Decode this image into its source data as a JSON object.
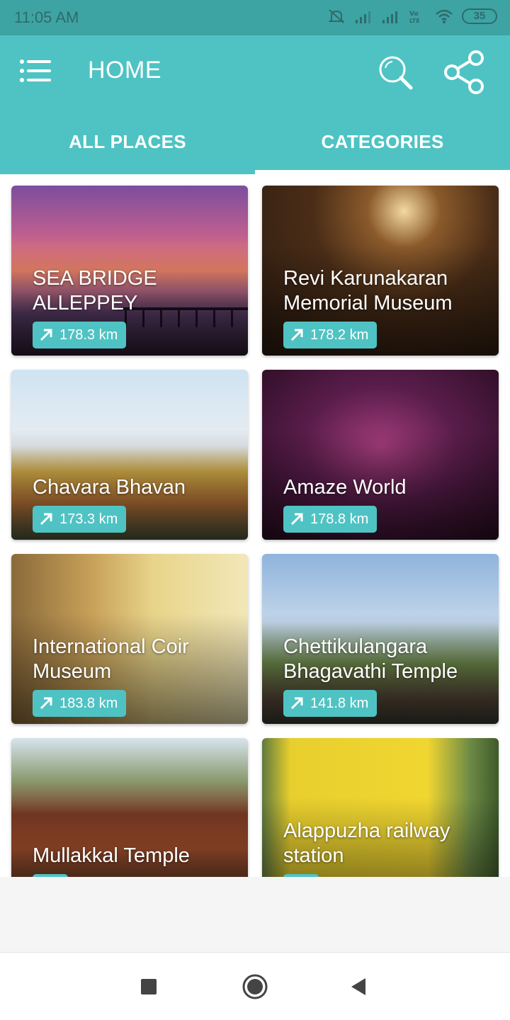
{
  "status_bar": {
    "time": "11:05 AM",
    "battery": "35"
  },
  "app_bar": {
    "title": "HOME"
  },
  "tabs": [
    {
      "label": "ALL PLACES"
    },
    {
      "label": "CATEGORIES"
    }
  ],
  "places": [
    {
      "name": "SEA BRIDGE ALLEPPEY",
      "distance": "178.3 km"
    },
    {
      "name": "Revi Karunakaran Memorial Museum",
      "distance": "178.2 km"
    },
    {
      "name": "Chavara Bhavan",
      "distance": "173.3 km"
    },
    {
      "name": "Amaze World",
      "distance": "178.8 km"
    },
    {
      "name": "International Coir Museum",
      "distance": "183.8 km"
    },
    {
      "name": "Chettikulangara Bhagavathi Temple",
      "distance": "141.8 km"
    },
    {
      "name": "Mullakkal Temple",
      "distance": ""
    },
    {
      "name": "Alappuzha railway station",
      "distance": ""
    }
  ],
  "theme": {
    "primary": "#4fc3c3",
    "status_bar": "#3ea3a3"
  },
  "icons": {
    "menu": "menu-list-icon",
    "search": "search-icon",
    "share": "share-icon",
    "distance": "arrow-up-right-icon"
  }
}
